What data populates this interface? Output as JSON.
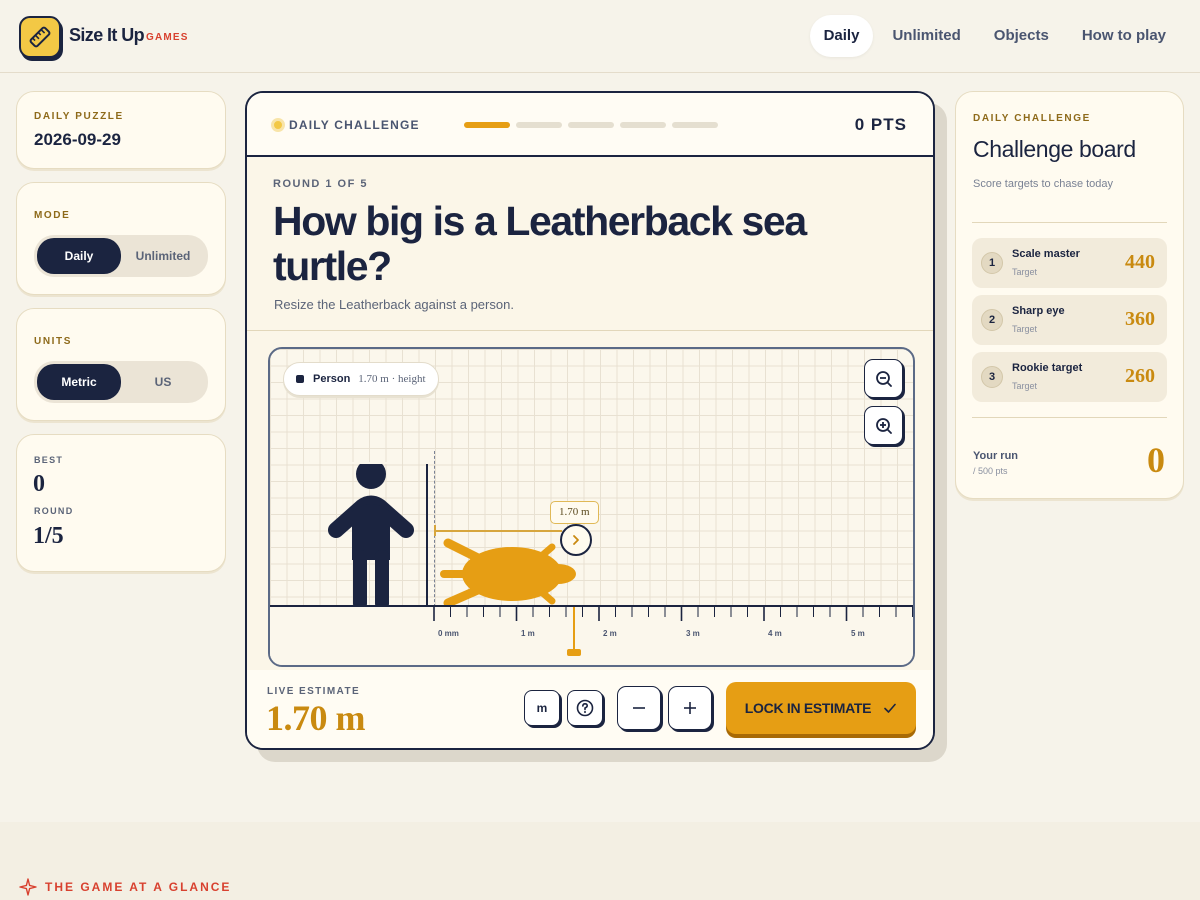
{
  "brand": {
    "name": "Size It Up",
    "sub": "GAMES"
  },
  "nav": [
    {
      "label": "Daily",
      "active": true
    },
    {
      "label": "Unlimited",
      "active": false
    },
    {
      "label": "Objects",
      "active": false
    },
    {
      "label": "How to play",
      "active": false
    }
  ],
  "daily_puzzle": {
    "label": "DAILY PUZZLE",
    "date": "2026-09-29"
  },
  "mode": {
    "label": "MODE",
    "options": [
      "Daily",
      "Unlimited"
    ],
    "selected": "Daily"
  },
  "units": {
    "label": "UNITS",
    "options": [
      "Metric",
      "US"
    ],
    "selected": "Metric"
  },
  "stats": {
    "best_label": "BEST",
    "best": "0",
    "round_label": "ROUND",
    "round": "1/5"
  },
  "challenge": {
    "label": "DAILY CHALLENGE",
    "points": "0 PTS",
    "progress_total": 5,
    "progress_current": 1,
    "round_text": "ROUND 1 OF 5",
    "question": "How big is a Leatherback sea turtle?",
    "subtitle": "Resize the Leatherback against a person."
  },
  "stage": {
    "reference": {
      "name": "Person",
      "meta": "1.70 m · height"
    },
    "measure_label": "1.70 m",
    "ruler_labels": [
      "0 mm",
      "1 m",
      "2 m",
      "3 m",
      "4 m",
      "5 m"
    ],
    "zoom_out_icon": "zoom-out-icon",
    "zoom_in_icon": "zoom-in-icon",
    "turtle_color": "#e69e14",
    "person_color": "#1b2440"
  },
  "controls": {
    "live_label": "LIVE ESTIMATE",
    "live_value": "1.70 m",
    "unit_button": "m",
    "lock_button": "LOCK IN ESTIMATE"
  },
  "board": {
    "eyebrow": "DAILY CHALLENGE",
    "title": "Challenge board",
    "subtitle": "Score targets to chase today",
    "rows": [
      {
        "rank": "1",
        "name": "Scale master",
        "tag": "Target",
        "points": "440"
      },
      {
        "rank": "2",
        "name": "Sharp eye",
        "tag": "Target",
        "points": "360"
      },
      {
        "rank": "3",
        "name": "Rookie target",
        "tag": "Target",
        "points": "260"
      }
    ],
    "run_label": "Your run",
    "run_sub": "/ 500 pts",
    "run_value": "0"
  },
  "glance": {
    "label": "THE GAME AT A GLANCE"
  },
  "colors": {
    "accent": "#e69e14",
    "navy": "#1b2440",
    "brand_red": "#d8412f",
    "bg": "#f6f3ea"
  }
}
